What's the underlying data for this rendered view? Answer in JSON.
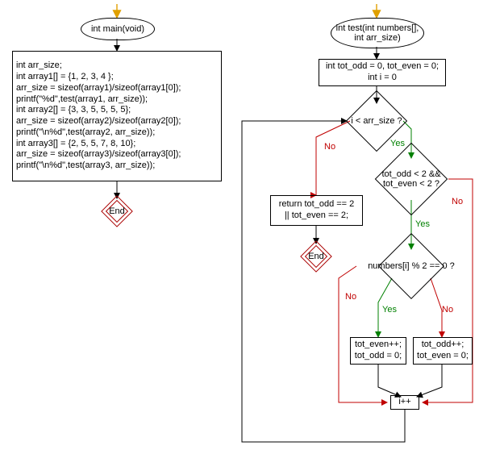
{
  "chart_data": [
    {
      "type": "flowchart",
      "title": "main",
      "nodes": [
        {
          "id": "main_start",
          "kind": "start",
          "text": "int main(void)"
        },
        {
          "id": "main_body",
          "kind": "process",
          "text": "int arr_size;\nint array1[] = {1, 2, 3, 4 };\narr_size = sizeof(array1)/sizeof(array1[0]);\nprintf(\"%d\",test(array1, arr_size));\nint array2[] = {3, 3, 5, 5, 5, 5};\narr_size = sizeof(array2)/sizeof(array2[0]);\nprintf(\"\\n%d\",test(array2, arr_size));\nint array3[] = {2, 5, 5, 7, 8, 10};\narr_size = sizeof(array3)/sizeof(array3[0]);\nprintf(\"\\n%d\",test(array3, arr_size));"
        },
        {
          "id": "main_end",
          "kind": "end",
          "text": "End"
        }
      ],
      "edges": [
        {
          "from": "entry",
          "to": "main_start"
        },
        {
          "from": "main_start",
          "to": "main_body"
        },
        {
          "from": "main_body",
          "to": "main_end"
        }
      ]
    },
    {
      "type": "flowchart",
      "title": "test",
      "nodes": [
        {
          "id": "test_start",
          "kind": "start",
          "text": "int test(int numbers[],\nint arr_size)"
        },
        {
          "id": "init",
          "kind": "process",
          "text": "int tot_odd = 0, tot_even = 0;\nint i = 0"
        },
        {
          "id": "cond_i",
          "kind": "decision",
          "text": "i < arr_size ?"
        },
        {
          "id": "ret",
          "kind": "process",
          "text": "return tot_odd == 2\n|| tot_even == 2;"
        },
        {
          "id": "test_end",
          "kind": "end",
          "text": "End"
        },
        {
          "id": "cond_counts",
          "kind": "decision",
          "text": "tot_odd < 2 &&\ntot_even < 2 ?"
        },
        {
          "id": "cond_mod",
          "kind": "decision",
          "text": "numbers[i] % 2 == 0 ?"
        },
        {
          "id": "inc_even",
          "kind": "process",
          "text": "tot_even++;\ntot_odd = 0;"
        },
        {
          "id": "inc_odd",
          "kind": "process",
          "text": "tot_odd++;\ntot_even = 0;"
        },
        {
          "id": "ipp",
          "kind": "process",
          "text": "i++"
        }
      ],
      "edges": [
        {
          "from": "entry",
          "to": "test_start"
        },
        {
          "from": "test_start",
          "to": "init"
        },
        {
          "from": "init",
          "to": "cond_i"
        },
        {
          "from": "cond_i",
          "to": "ret",
          "label": "No"
        },
        {
          "from": "cond_i",
          "to": "cond_counts",
          "label": "Yes"
        },
        {
          "from": "ret",
          "to": "test_end"
        },
        {
          "from": "cond_counts",
          "to": "cond_mod",
          "label": "Yes"
        },
        {
          "from": "cond_counts",
          "to": "ipp",
          "label": "No"
        },
        {
          "from": "cond_mod",
          "to": "inc_even",
          "label": "Yes"
        },
        {
          "from": "cond_mod",
          "to": "inc_odd",
          "label": "No"
        },
        {
          "from": "inc_even",
          "to": "ipp"
        },
        {
          "from": "inc_odd",
          "to": "ipp"
        },
        {
          "from": "ipp",
          "to": "cond_i"
        }
      ]
    }
  ],
  "labels": {
    "yes": "Yes",
    "no": "No",
    "end": "End"
  },
  "colors": {
    "yes": "#008000",
    "no": "#c00000",
    "end_border": "#a00000",
    "arrow": "#e0a000"
  }
}
